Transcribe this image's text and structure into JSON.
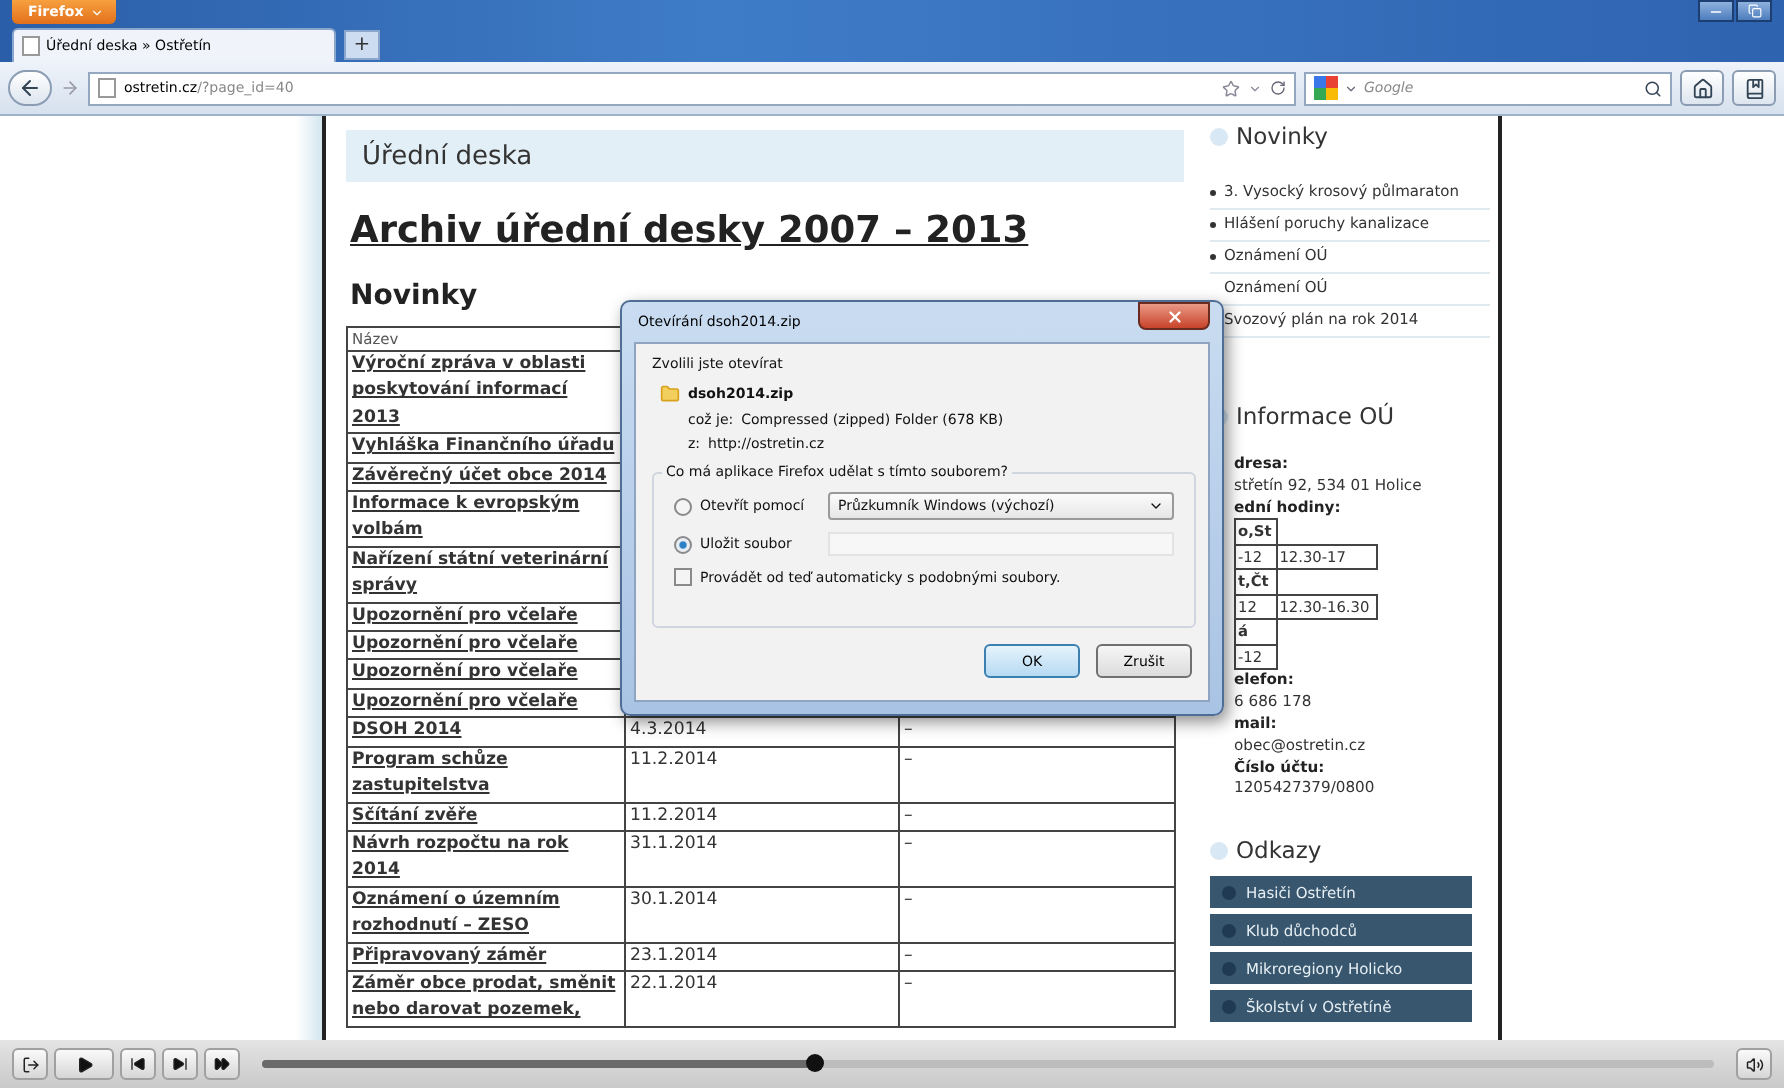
{
  "browser": {
    "menu_button": "Firefox",
    "tabs": [
      {
        "label": "Úřední deska » Ostřetín",
        "selected": true
      }
    ],
    "new_tab": "+",
    "url": {
      "host": "ostretin.cz",
      "path": "/?page_id=40"
    },
    "search_placeholder": "Google"
  },
  "page": {
    "section_title": "Úřední deska",
    "heading": "Archiv úřední desky 2007 – 2013",
    "subheading": "Novinky",
    "table": {
      "columns": [
        "Název"
      ],
      "rows": [
        {
          "title": "Výroční zpráva v oblasti poskytování informací 2013"
        },
        {
          "title": "Vyhláška Finančního úřadu"
        },
        {
          "title": "Závěrečný účet obce 2014"
        },
        {
          "title": "Informace k evropským volbám"
        },
        {
          "title": "Nařízení státní veterinární správy"
        },
        {
          "title": "Upozornění pro včelaře"
        },
        {
          "title": "Upozornění pro včelaře"
        },
        {
          "title": "Upozornění pro včelaře"
        },
        {
          "title": "Upozornění pro včelaře"
        },
        {
          "title": "DSOH 2014",
          "date": "4.3.2014",
          "column_3": "–"
        },
        {
          "title": "Program schůze zastupitelstva",
          "date": "11.2.2014",
          "column_3": "–"
        },
        {
          "title": "Sčítání zvěře",
          "date": "11.2.2014",
          "column_3": "–"
        },
        {
          "title": "Návrh rozpočtu na rok 2014",
          "date": "31.1.2014",
          "column_3": "–"
        },
        {
          "title": "Oznámení o územním rozhodnutí – ZESO",
          "date": "30.1.2014",
          "column_3": "–"
        },
        {
          "title": "Připravovaný záměr",
          "date": "23.1.2014",
          "column_3": "–"
        },
        {
          "title": "Záměr obce prodat, směnit nebo darovat pozemek,",
          "date": "22.1.2014",
          "column_3": "–"
        }
      ]
    }
  },
  "sidebar": {
    "news_title": "Novinky",
    "news": [
      {
        "label": "3. Vysocký krosový půlmaraton",
        "bullet": true
      },
      {
        "label": "Hlášení poruchy kanalizace",
        "bullet": true
      },
      {
        "label": "Oznámení OÚ",
        "bullet": true
      },
      {
        "label": "Oznámení OÚ"
      },
      {
        "label": "Svozový plán na rok 2014"
      }
    ],
    "info_title": "Informace OÚ",
    "info": [
      {
        "kind": "label",
        "text": "dresa:"
      },
      {
        "kind": "text",
        "text": "střetín 92, 534 01 Holice"
      },
      {
        "kind": "label",
        "text": "ední hodiny:"
      },
      {
        "kind": "hours",
        "rows": [
          [
            "o,St"
          ],
          [
            "-12",
            "12.30-17"
          ],
          [
            "t,Čt"
          ],
          [
            "12",
            "12.30-16.30"
          ],
          [
            "á"
          ],
          [
            "-12"
          ]
        ]
      },
      {
        "kind": "label",
        "text": "elefon:"
      },
      {
        "kind": "text",
        "text": "6 686 178"
      },
      {
        "kind": "label",
        "text": "mail:"
      },
      {
        "kind": "text",
        "text": "obec@ostretin.cz"
      },
      {
        "kind": "label",
        "text": "Číslo účtu:"
      },
      {
        "kind": "text",
        "text": "1205427379/0800"
      }
    ],
    "links_title": "Odkazy",
    "links": [
      "Hasiči Ostřetín",
      "Klub důchodců",
      "Mikroregiony Holicko",
      "Školství v Ostřetíně"
    ]
  },
  "dialog": {
    "title": "Otevírání dsoh2014.zip",
    "intro": "Zvolili jste otevírat",
    "file": "dsoh2014.zip",
    "type_label": "což je:",
    "type": "Compressed (zipped) Folder (678 KB)",
    "from_label": "z:",
    "from": "http://ostretin.cz",
    "question": "Co má aplikace Firefox udělat s tímto souborem?",
    "options": [
      {
        "kind": "open_with",
        "label": "Otevřít pomocí",
        "selected": false,
        "app": "Průzkumník Windows (výchozí)"
      },
      {
        "kind": "save",
        "label": "Uložit soubor",
        "selected": true
      }
    ],
    "auto": {
      "label": "Provádět od teď automaticky s podobnými soubory.",
      "checked": false
    },
    "buttons": [
      {
        "label": "OK",
        "default": true
      },
      {
        "label": "Zrušit",
        "default": false
      }
    ]
  },
  "player": {
    "level": 0.38
  }
}
